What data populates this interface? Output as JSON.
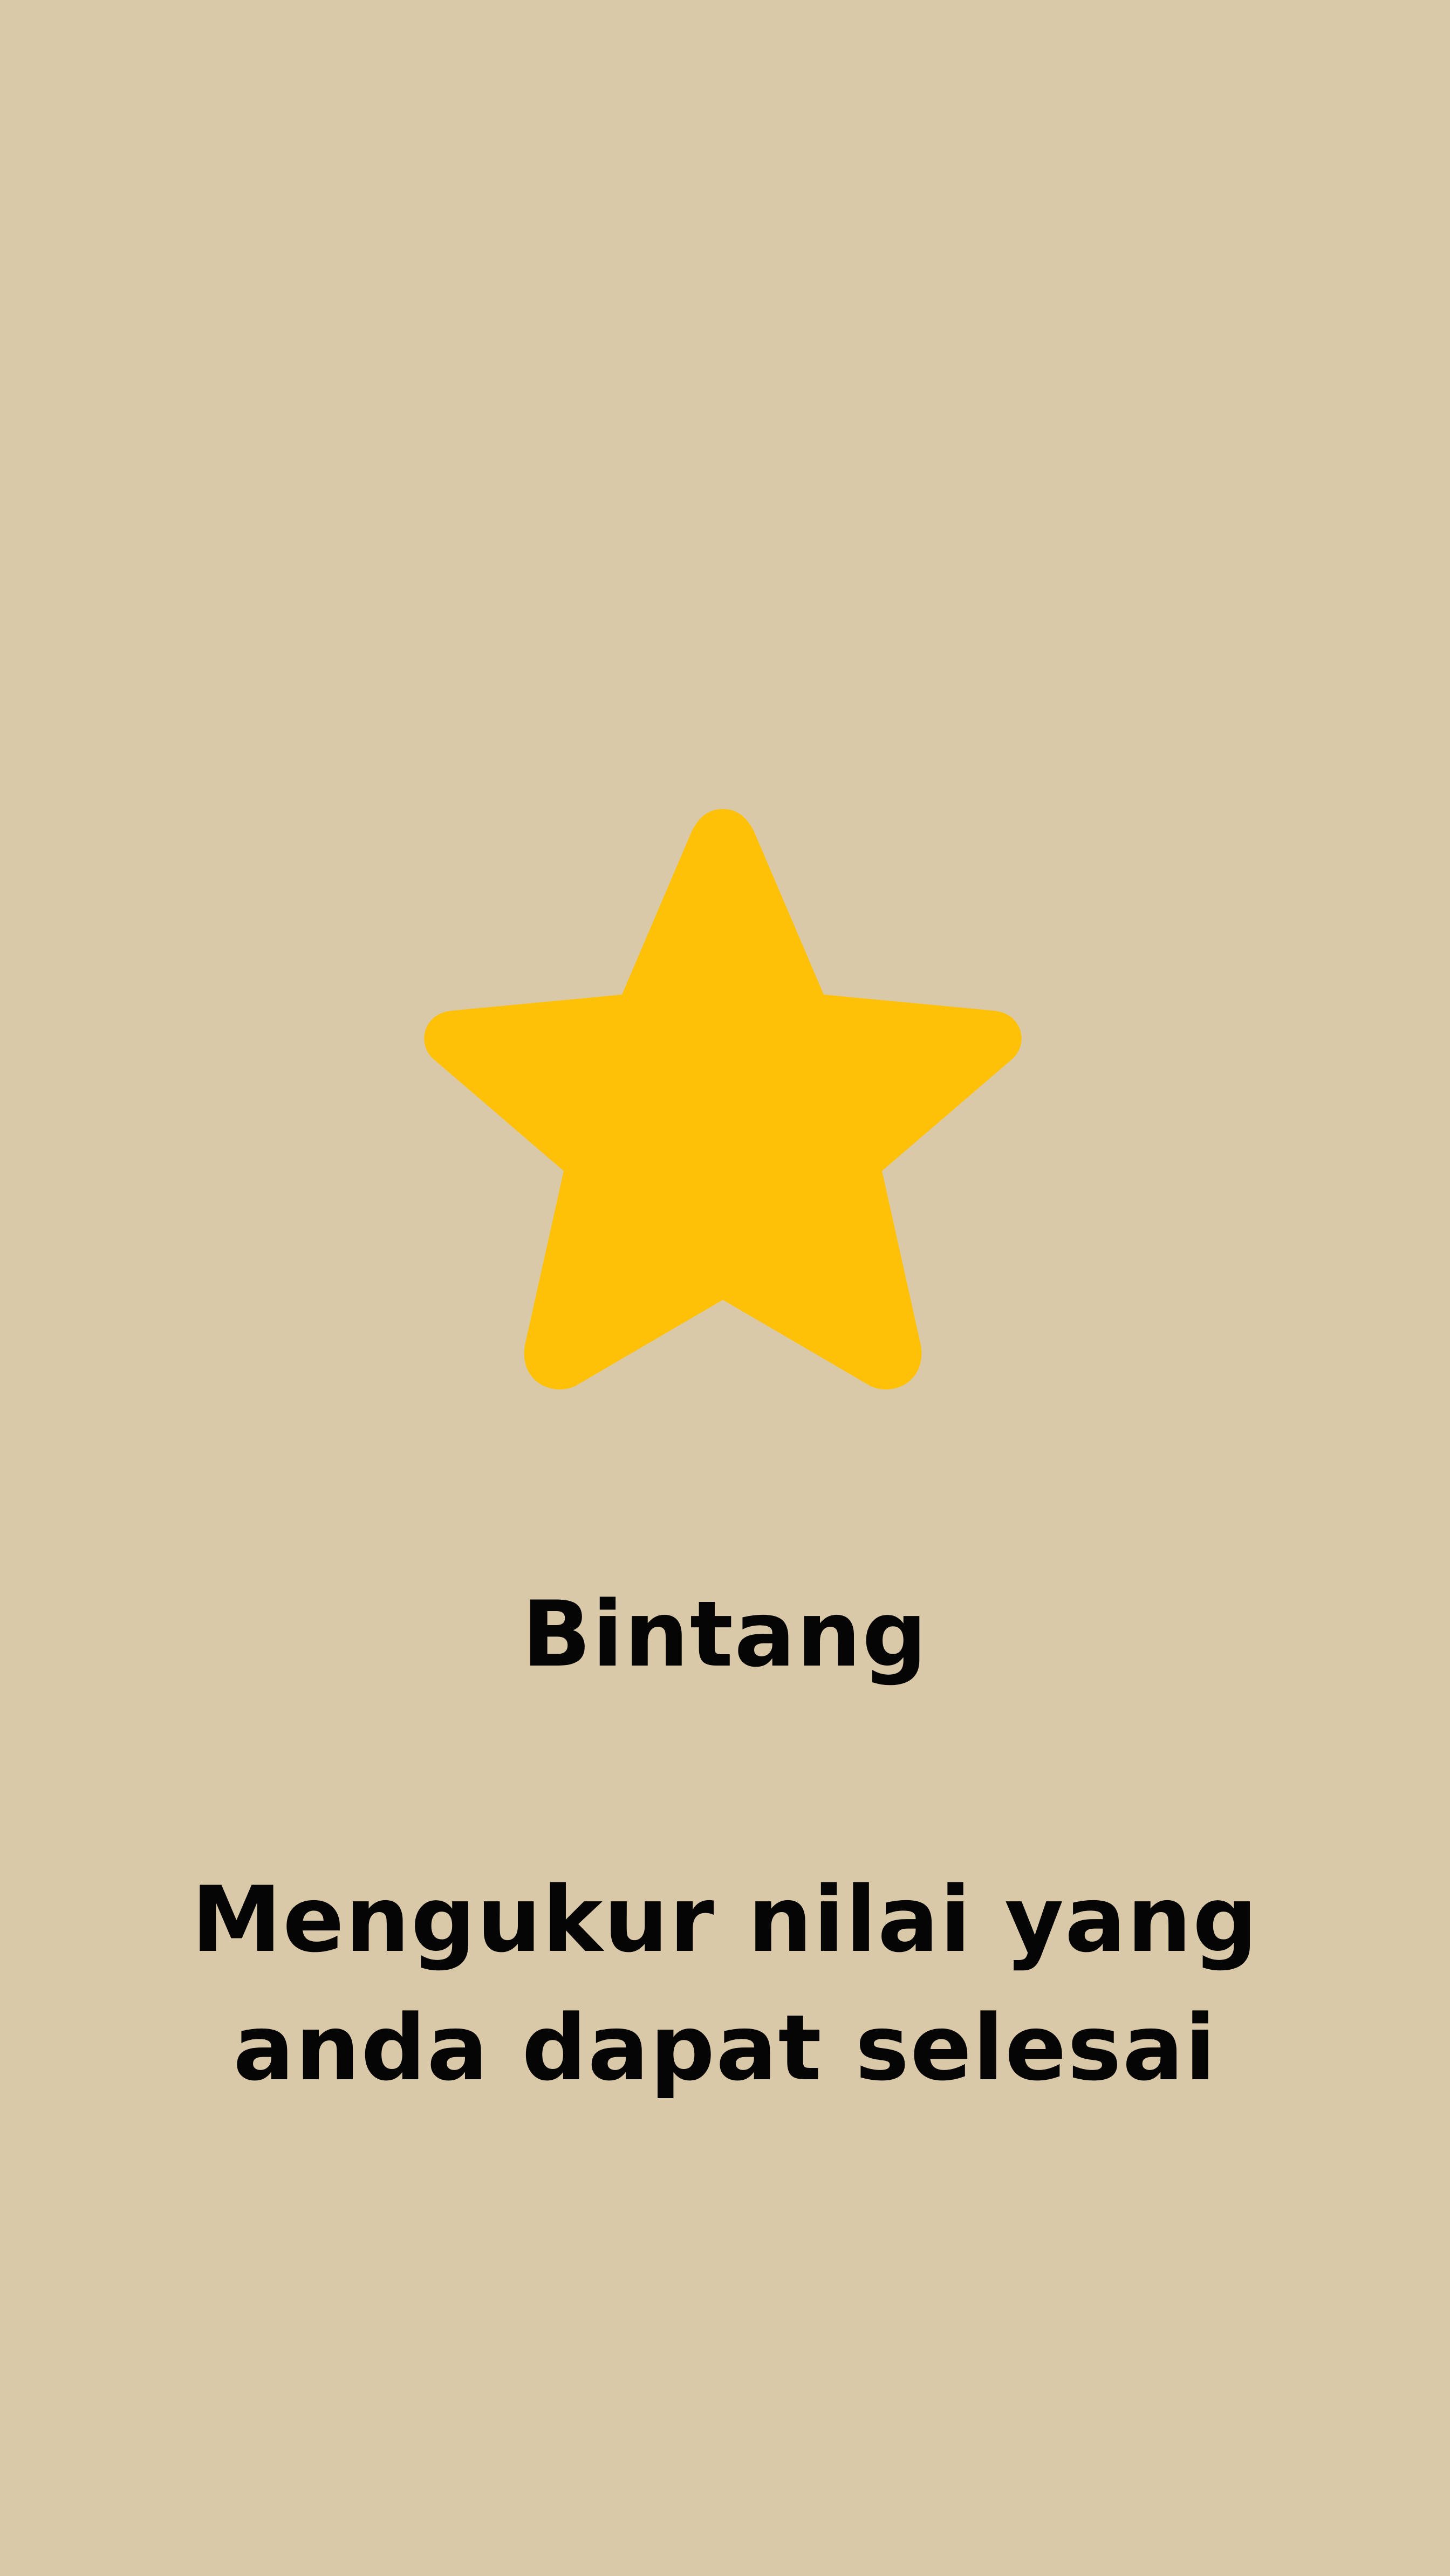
{
  "screen": {
    "background_color": "#d9c9a8"
  },
  "star": {
    "icon": "star-icon",
    "color": "#ffc107"
  },
  "title": "Bintang",
  "description": "Mengukur nilai yang anda dapat selesai"
}
